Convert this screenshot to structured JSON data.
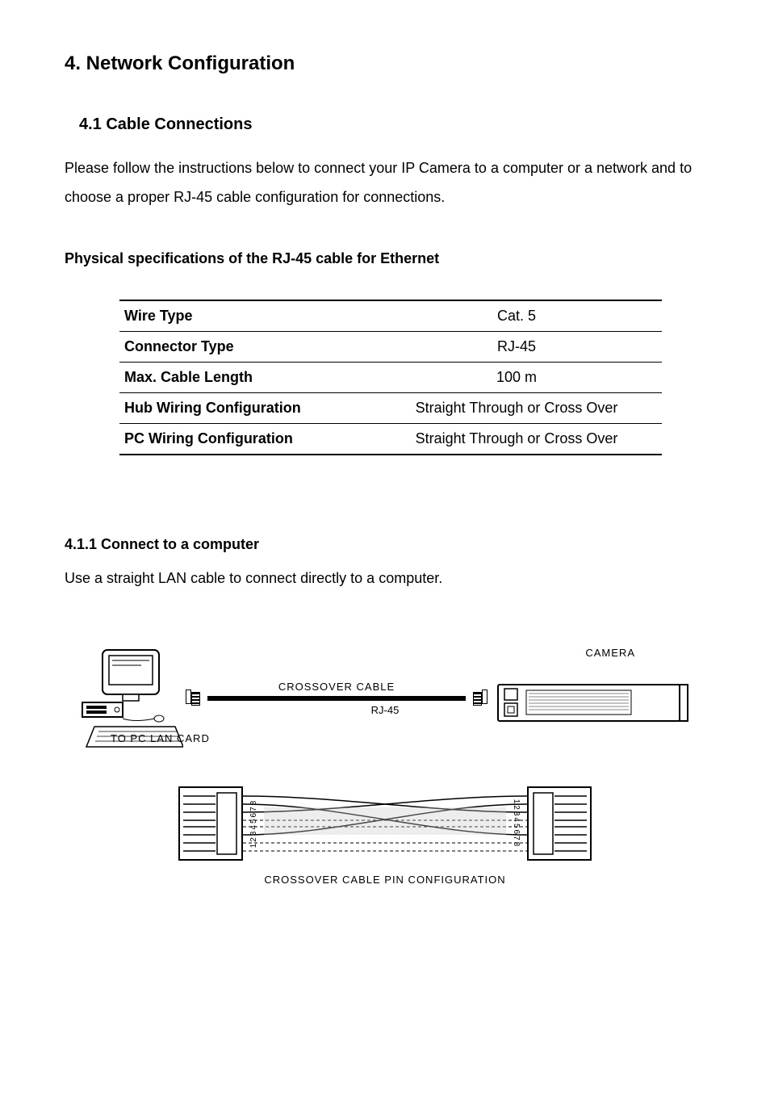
{
  "heading": "4. Network Configuration",
  "subsection": {
    "title": "4.1 Cable Connections",
    "intro": "Please follow the instructions below to connect your IP Camera to a computer or a network and to choose a proper RJ-45 cable configuration for connections."
  },
  "spec": {
    "heading": "Physical specifications of the RJ-45 cable for Ethernet",
    "rows": [
      {
        "label": "Wire Type",
        "value": "Cat. 5"
      },
      {
        "label": "Connector Type",
        "value": "RJ-45"
      },
      {
        "label": "Max. Cable Length",
        "value": "100 m"
      },
      {
        "label": "Hub Wiring Configuration",
        "value": "Straight Through or Cross Over"
      },
      {
        "label": "PC Wiring Configuration",
        "value": "Straight Through or Cross Over"
      }
    ]
  },
  "connect": {
    "heading": "4.1.1 Connect to a computer",
    "text": "Use a straight LAN cable to connect directly to a computer."
  },
  "diagram": {
    "camera_label": "CAMERA",
    "cable_label": "CROSSOVER CABLE",
    "rj45_label": "RJ-45",
    "lan_label": "TO PC LAN CARD",
    "pin_caption": "CROSSOVER CABLE PIN CONFIGURATION",
    "pins_left": "12345678",
    "pins_right": "12345678"
  }
}
